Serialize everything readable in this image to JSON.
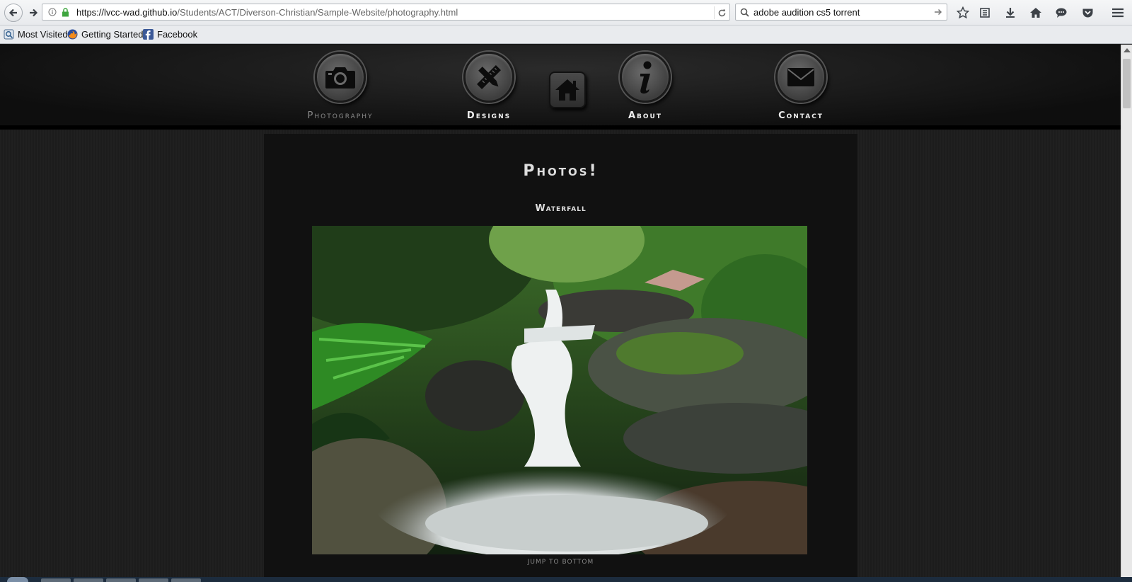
{
  "browser": {
    "url_host": "https://lvcc-wad.github.io",
    "url_path": "/Students/ACT/Diverson-Christian/Sample-Website/photography.html",
    "search_value": "adobe audition cs5 torrent"
  },
  "bookmarks": [
    {
      "label": "Most Visited",
      "icon": "most-visited-icon"
    },
    {
      "label": "Getting Started",
      "icon": "firefox-icon"
    },
    {
      "label": "Facebook",
      "icon": "facebook-icon"
    }
  ],
  "nav": {
    "photography": "Photography",
    "designs": "Designs",
    "about": "About",
    "contact": "Contact"
  },
  "content": {
    "title": "Photos!",
    "photo_title": "Waterfall",
    "jump_link": "jump to bottom"
  }
}
